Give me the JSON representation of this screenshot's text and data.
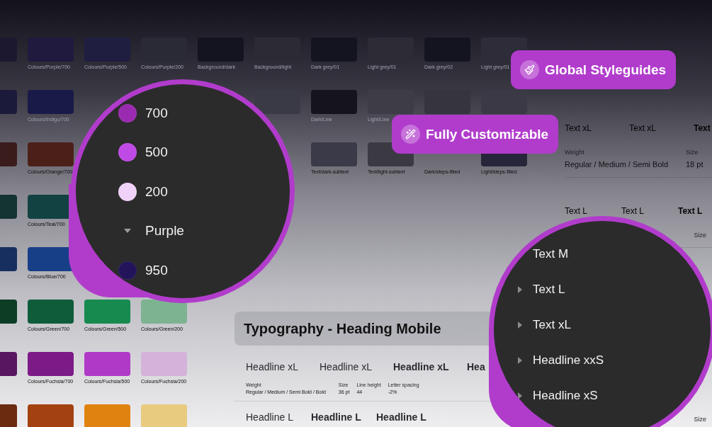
{
  "swatches": {
    "rows": [
      {
        "cells": [
          {
            "kind": "swatch",
            "color": "#1b1830"
          },
          {
            "kind": "swatch",
            "color": "#201a3e",
            "label": "Colours/Purple/700"
          },
          {
            "kind": "swatch",
            "color": "#1f1d40",
            "label": "Colours/Purple/500"
          },
          {
            "kind": "swatch",
            "color": "#2a2936",
            "label": "Colours/Purple/200"
          },
          {
            "kind": "swatch",
            "color": "#141320",
            "label": "Background/dark"
          },
          {
            "kind": "swatch",
            "color": "#2c2b35",
            "label": "Background/light"
          },
          {
            "kind": "swatch",
            "color": "#141320",
            "label": "Dark grey/01"
          },
          {
            "kind": "swatch",
            "color": "#2c2b36",
            "label": "Light grey/01"
          },
          {
            "kind": "swatch",
            "color": "#141320",
            "label": "Dark grey/02"
          },
          {
            "kind": "swatch",
            "color": "#2d2c38",
            "label": "Light grey/01"
          }
        ]
      },
      {
        "cells": [
          {
            "kind": "swatch",
            "color": "#1c1a3a"
          },
          {
            "kind": "swatch",
            "color": "#1a1a48",
            "label": "Colours/Indigo/700"
          },
          {
            "kind": "empty"
          },
          {
            "kind": "empty"
          },
          {
            "kind": "empty"
          },
          {
            "kind": "swatch",
            "color": "#3a3946"
          },
          {
            "kind": "swatch",
            "color": "#15141c",
            "label": "Dark/Line"
          },
          {
            "kind": "swatch",
            "color": "#3d3c47",
            "label": "Light/Line"
          },
          {
            "kind": "swatch",
            "color": "#35343f"
          },
          {
            "kind": "swatch",
            "color": "#3a3945"
          }
        ]
      },
      {
        "cells": [
          {
            "kind": "swatch",
            "color": "#3a1c1c"
          },
          {
            "kind": "swatch",
            "color": "#4c2019",
            "label": "Colours/Orange/700"
          },
          {
            "kind": "empty"
          },
          {
            "kind": "empty"
          },
          {
            "kind": "empty"
          },
          {
            "kind": "empty"
          },
          {
            "kind": "swatch",
            "color": "#3a3a48",
            "label": "Text/dark-subtext"
          },
          {
            "kind": "swatch",
            "color": "#3b3a43",
            "label": "Text/light-subtext"
          },
          {
            "kind": "label",
            "label": "Dark/steps-filled"
          },
          {
            "kind": "swatch",
            "color": "#26253a",
            "label": "Light/steps-filled"
          }
        ]
      },
      {
        "cells": [
          {
            "kind": "swatch",
            "color": "#143333"
          },
          {
            "kind": "swatch",
            "color": "#124242",
            "label": "Colours/Teal/700"
          }
        ]
      },
      {
        "cells": [
          {
            "kind": "swatch",
            "color": "#172f5e"
          },
          {
            "kind": "swatch",
            "color": "#173f88",
            "label": "Colours/Blue/700"
          }
        ]
      },
      {
        "cells": [
          {
            "kind": "swatch",
            "color": "#0c3d25"
          },
          {
            "kind": "swatch",
            "color": "#0f5c3a",
            "label": "Colours/Green/700"
          },
          {
            "kind": "swatch",
            "color": "#178a50",
            "label": "Colours/Green/500"
          },
          {
            "kind": "swatch",
            "color": "#7db390",
            "label": "Colours/Green/200"
          }
        ]
      },
      {
        "cells": [
          {
            "kind": "swatch",
            "color": "#581660"
          },
          {
            "kind": "swatch",
            "color": "#7c1a88",
            "label": "Colours/Fuchsia/700"
          },
          {
            "kind": "swatch",
            "color": "#b03ac7",
            "label": "Colours/Fuchsia/500"
          },
          {
            "kind": "swatch",
            "color": "#d4b2d9",
            "label": "Colours/Fuchsia/200"
          }
        ]
      },
      {
        "cells": [
          {
            "kind": "swatch",
            "color": "#6a2b10"
          },
          {
            "kind": "swatch",
            "color": "#a34210"
          },
          {
            "kind": "swatch",
            "color": "#e0820f"
          },
          {
            "kind": "swatch",
            "color": "#e9cb80"
          }
        ]
      }
    ]
  },
  "typography_panel": {
    "title": "Typography - Heading Mobile",
    "samples": [
      "Headline xL",
      "Headline xL",
      "Headline xL",
      "Hea"
    ],
    "meta": [
      {
        "label": "Weight",
        "value": "Regular / Medium / Semi Bold / Bold"
      },
      {
        "label": "Size",
        "value": "36 pt"
      },
      {
        "label": "Line height",
        "value": "44"
      },
      {
        "label": "Letter spacing",
        "value": "-2%"
      }
    ],
    "next_samples": [
      "Headline L",
      "Headline L",
      "Headline L"
    ]
  },
  "text_styles": [
    {
      "samples": [
        "Text xL",
        "Text xL",
        "Text"
      ],
      "meta": [
        {
          "label": "Weight",
          "value": "Regular / Medium / Semi Bold"
        },
        {
          "label": "Size",
          "value": "18 pt"
        }
      ]
    },
    {
      "samples": [
        "Text L",
        "Text L",
        "Text L"
      ],
      "meta": [
        {
          "label": "Size"
        }
      ]
    },
    {
      "meta": [
        {
          "label": "Size"
        }
      ]
    }
  ],
  "color_layers": [
    {
      "kind": "swatch",
      "label": "700",
      "color": "#9a2ab0"
    },
    {
      "kind": "swatch",
      "label": "500",
      "color": "#c04ae6"
    },
    {
      "kind": "swatch",
      "label": "200",
      "color": "#f0d2f8"
    },
    {
      "kind": "group",
      "label": "Purple",
      "expanded": true
    },
    {
      "kind": "swatch",
      "label": "950",
      "color": "#23135a"
    }
  ],
  "text_layers": [
    {
      "kind": "leaf",
      "label": "Text M"
    },
    {
      "kind": "group",
      "label": "Text L",
      "expanded": false
    },
    {
      "kind": "group",
      "label": "Text xL",
      "expanded": false
    },
    {
      "kind": "group",
      "label": "Headline xxS",
      "expanded": false
    },
    {
      "kind": "group",
      "label": "Headline xS",
      "expanded": false
    }
  ],
  "badges": [
    {
      "kind": "brush",
      "label": "Global Styleguides"
    },
    {
      "kind": "wand",
      "label": "Fully Customizable"
    }
  ]
}
